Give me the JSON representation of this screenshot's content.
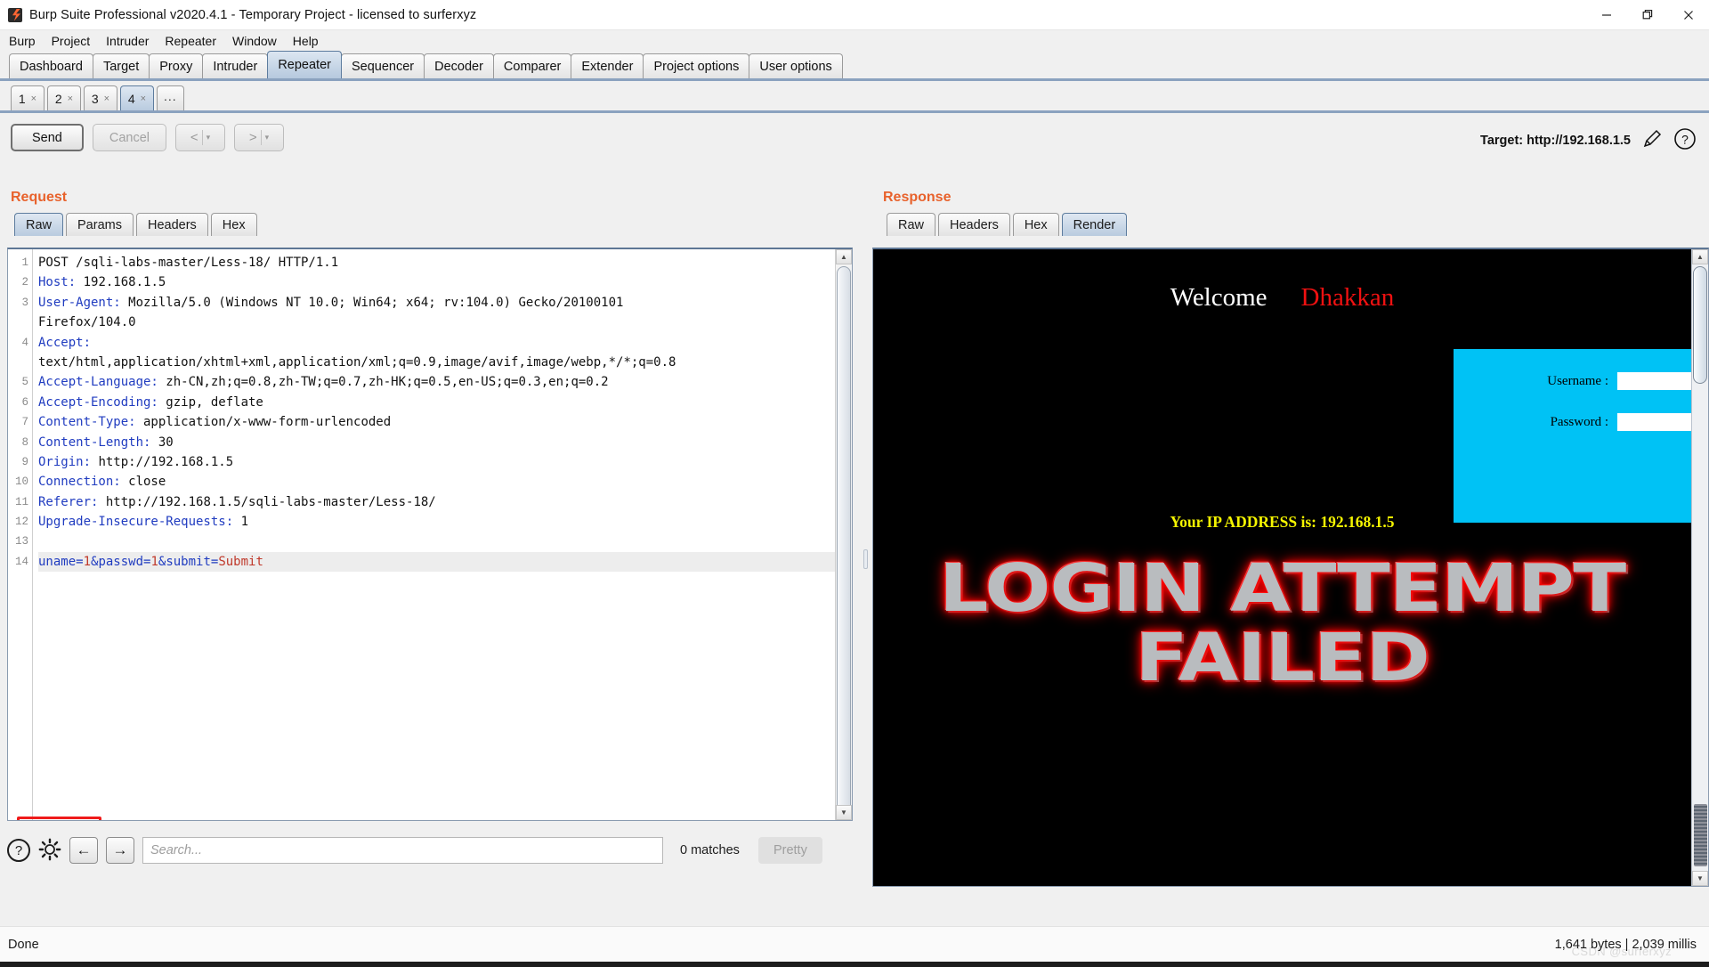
{
  "window": {
    "title": "Burp Suite Professional v2020.4.1 - Temporary Project - licensed to surferxyz",
    "app_icon": "burp-logo-icon",
    "controls": {
      "minimize": "minimize-icon",
      "maximize": "maximize-icon",
      "close": "close-icon"
    }
  },
  "menu": {
    "items": [
      "Burp",
      "Project",
      "Intruder",
      "Repeater",
      "Window",
      "Help"
    ]
  },
  "main_tabs": {
    "selected": "Repeater",
    "items": [
      "Dashboard",
      "Target",
      "Proxy",
      "Intruder",
      "Repeater",
      "Sequencer",
      "Decoder",
      "Comparer",
      "Extender",
      "Project options",
      "User options"
    ]
  },
  "repeater_tabs": {
    "selected": "4",
    "items": [
      "1",
      "2",
      "3",
      "4"
    ],
    "close_glyph": "×",
    "more_label": "..."
  },
  "action_bar": {
    "send": "Send",
    "cancel": "Cancel",
    "back": "<",
    "forward": ">",
    "caret": "▾",
    "target_label": "Target: http://192.168.1.5",
    "edit_icon": "pencil-icon",
    "help_icon": "question-mark-icon"
  },
  "request": {
    "title": "Request",
    "tabs": {
      "selected": "Raw",
      "items": [
        "Raw",
        "Params",
        "Headers",
        "Hex"
      ]
    },
    "lines": [
      {
        "n": "1",
        "key": "",
        "value": "POST /sqli-labs-master/Less-18/ HTTP/1.1",
        "plain": true
      },
      {
        "n": "2",
        "key": "Host:",
        "value": " 192.168.1.5"
      },
      {
        "n": "3",
        "key": "User-Agent:",
        "value": " Mozilla/5.0 (Windows NT 10.0; Win64; x64; rv:104.0) Gecko/20100101"
      },
      {
        "n": "",
        "key": "",
        "value": "Firefox/104.0",
        "plain": true
      },
      {
        "n": "4",
        "key": "Accept:",
        "value": ""
      },
      {
        "n": "",
        "key": "",
        "value": "text/html,application/xhtml+xml,application/xml;q=0.9,image/avif,image/webp,*/*;q=0.8",
        "plain": true
      },
      {
        "n": "5",
        "key": "Accept-Language:",
        "value": " zh-CN,zh;q=0.8,zh-TW;q=0.7,zh-HK;q=0.5,en-US;q=0.3,en;q=0.2"
      },
      {
        "n": "6",
        "key": "Accept-Encoding:",
        "value": " gzip, deflate"
      },
      {
        "n": "7",
        "key": "Content-Type:",
        "value": " application/x-www-form-urlencoded"
      },
      {
        "n": "8",
        "key": "Content-Length:",
        "value": " 30"
      },
      {
        "n": "9",
        "key": "Origin:",
        "value": " http://192.168.1.5"
      },
      {
        "n": "10",
        "key": "Connection:",
        "value": " close"
      },
      {
        "n": "11",
        "key": "Referer:",
        "value": " http://192.168.1.5/sqli-labs-master/Less-18/"
      },
      {
        "n": "12",
        "key": "Upgrade-Insecure-Requests:",
        "value": " 1"
      },
      {
        "n": "13",
        "key": "",
        "value": "",
        "plain": true
      }
    ],
    "body_line_number": "14",
    "body_tokens": [
      {
        "t": "uname=",
        "c": "k"
      },
      {
        "t": "1",
        "c": "v"
      },
      {
        "t": "&passwd=",
        "c": "k"
      },
      {
        "t": "1",
        "c": "v"
      },
      {
        "t": "&submit=",
        "c": "k"
      },
      {
        "t": "Submit",
        "c": "v"
      }
    ],
    "annotation": "red-highlight-box"
  },
  "find_bar": {
    "help_icon": "question-mark-icon",
    "settings_icon": "gear-icon",
    "prev_icon": "arrow-left-icon",
    "next_icon": "arrow-right-icon",
    "search_placeholder": "Search...",
    "search_value": "",
    "matches": "0 matches",
    "pretty": "Pretty"
  },
  "response": {
    "title": "Response",
    "tabs": {
      "selected": "Render",
      "items": [
        "Raw",
        "Headers",
        "Hex",
        "Render"
      ]
    },
    "render": {
      "welcome_text": "Welcome",
      "welcome_name": "Dhakkan",
      "form": {
        "username_label": "Username :",
        "password_label": "Password :",
        "username_value": "",
        "password_value": "",
        "panel_color": "#00c2f5"
      },
      "ip_line": "Your IP ADDRESS is: 192.168.1.5",
      "fail_line_1": "LOGIN ATTEMPT",
      "fail_line_2": "FAILED",
      "colors": {
        "background": "#000000",
        "welcome": "#ffffff",
        "name": "#f01111",
        "ip": "#f5f500",
        "glow": "#ff0000"
      }
    }
  },
  "status_bar": {
    "left": "Done",
    "right": "1,641 bytes | 2,039 millis",
    "watermark": "CSDN @surferxyz"
  }
}
